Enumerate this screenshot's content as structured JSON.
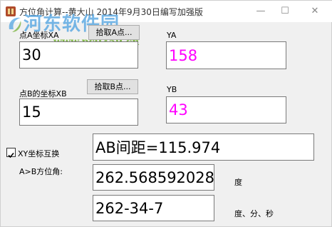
{
  "window": {
    "title": "方位角计算--黄大山 2014年9月30日编写加强版"
  },
  "watermark": {
    "name": "河东软件园",
    "url": "www.pc0359.cn"
  },
  "titlebar_buttons": {
    "minimize": "—",
    "maximize": "☐",
    "close": "✕"
  },
  "pointA": {
    "x_label": "点A坐标XA",
    "pick_button": "拾取A点...",
    "x_value": "30",
    "y_label": "YA",
    "y_value": "158"
  },
  "pointB": {
    "x_label": "点B的坐标XB",
    "pick_button": "拾取B点...",
    "x_value": "15",
    "y_label": "YB",
    "y_value": "43"
  },
  "swap": {
    "checked": true,
    "label": "XY坐标互换"
  },
  "distance": {
    "value": "AB间距=115.974"
  },
  "azimuth": {
    "label": "A>B方位角:",
    "degrees_value": "262.568592028",
    "degrees_unit": "度",
    "dms_value": "262-34-7",
    "dms_unit": "度、分、秒"
  },
  "colors": {
    "y_value_text": "#ff00ff",
    "x_value_text": "#000000"
  }
}
